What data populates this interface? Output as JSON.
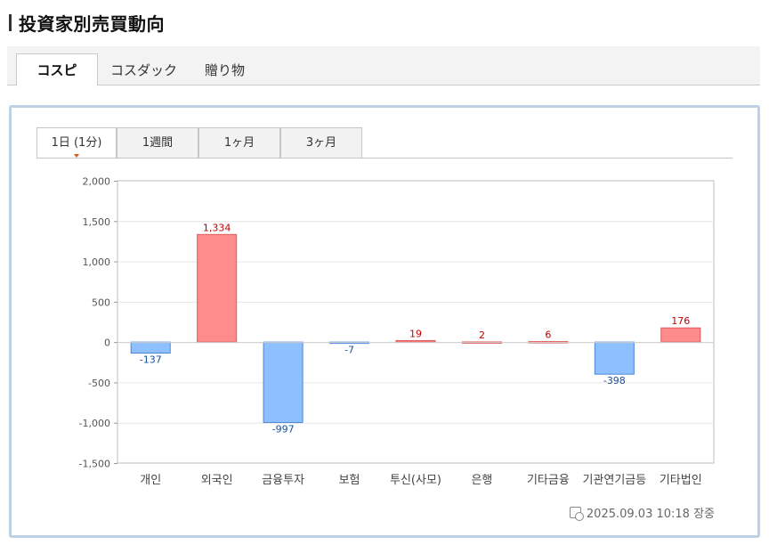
{
  "header": {
    "title": "投資家別売買動向"
  },
  "market_tabs": [
    {
      "label": "コスピ",
      "active": true
    },
    {
      "label": "コスダック",
      "active": false
    },
    {
      "label": "贈り物",
      "active": false
    }
  ],
  "period_tabs": [
    {
      "label": "1日 (1分)",
      "active": true
    },
    {
      "label": "1週間",
      "active": false
    },
    {
      "label": "1ヶ月",
      "active": false
    },
    {
      "label": "3ヶ月",
      "active": false
    }
  ],
  "colors": {
    "positive_fill": "#ff8c8c",
    "positive_stroke": "#e05a5a",
    "positive_label": "#c00000",
    "negative_fill": "#8ec0ff",
    "negative_stroke": "#4a86d6",
    "negative_label": "#1a4f9a",
    "panel_border": "#bcd0e6"
  },
  "chart_data": {
    "type": "bar",
    "categories": [
      "개인",
      "외국인",
      "금융투자",
      "보험",
      "투신(사모)",
      "은행",
      "기타금융",
      "기관연기금등",
      "기타법인"
    ],
    "values": [
      -137,
      1334,
      -997,
      -7,
      19,
      2,
      6,
      -398,
      176
    ],
    "value_labels": [
      "-137",
      "1,334",
      "-997",
      "-7",
      "19",
      "2",
      "6",
      "-398",
      "176"
    ],
    "ylim": [
      -1500,
      2000
    ],
    "yticks": [
      2000,
      1500,
      1000,
      500,
      0,
      -500,
      -1000,
      -1500
    ],
    "ytick_labels": [
      "2,000",
      "1,500",
      "1,000",
      "500",
      "0",
      "-500",
      "-1,000",
      "-1,500"
    ],
    "grid": true,
    "title": "",
    "xlabel": "",
    "ylabel": ""
  },
  "timestamp": {
    "text": "2025.09.03 10:18 장중",
    "icon": "calendar-clock-icon"
  }
}
